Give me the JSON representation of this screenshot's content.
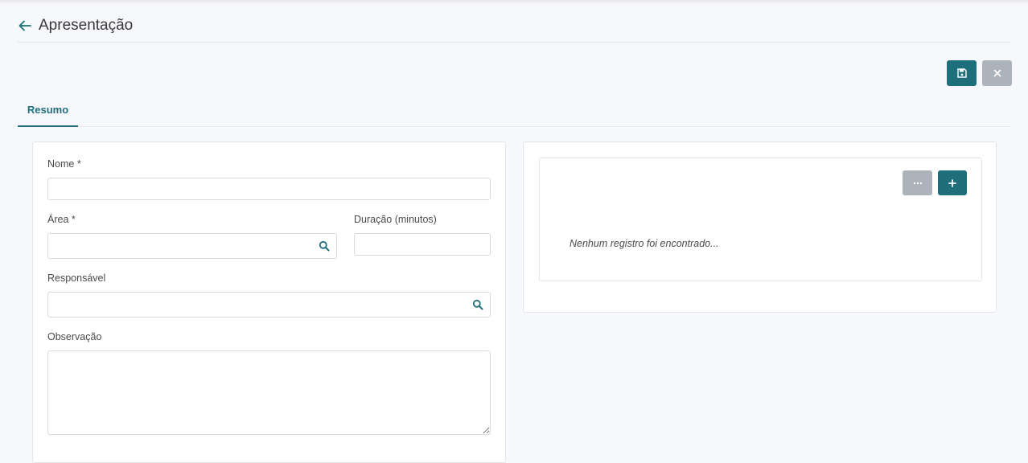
{
  "header": {
    "title": "Apresentação"
  },
  "toolbar": {
    "save_icon": "save-icon",
    "close_icon": "close-icon"
  },
  "tabs": [
    {
      "label": "Resumo",
      "active": true
    }
  ],
  "form": {
    "nome_label": "Nome *",
    "nome_value": "",
    "area_label": "Área *",
    "area_value": "",
    "duracao_label": "Duração (minutos)",
    "duracao_value": "",
    "responsavel_label": "Responsável",
    "responsavel_value": "",
    "observacao_label": "Observação",
    "observacao_value": ""
  },
  "side_panel": {
    "empty_message": "Nenhum registro foi encontrado...",
    "more_icon": "more-icon",
    "add_icon": "plus-icon"
  },
  "colors": {
    "primary": "#1f6e7c",
    "secondary": "#adb3ba",
    "background": "#f7f8fb"
  }
}
